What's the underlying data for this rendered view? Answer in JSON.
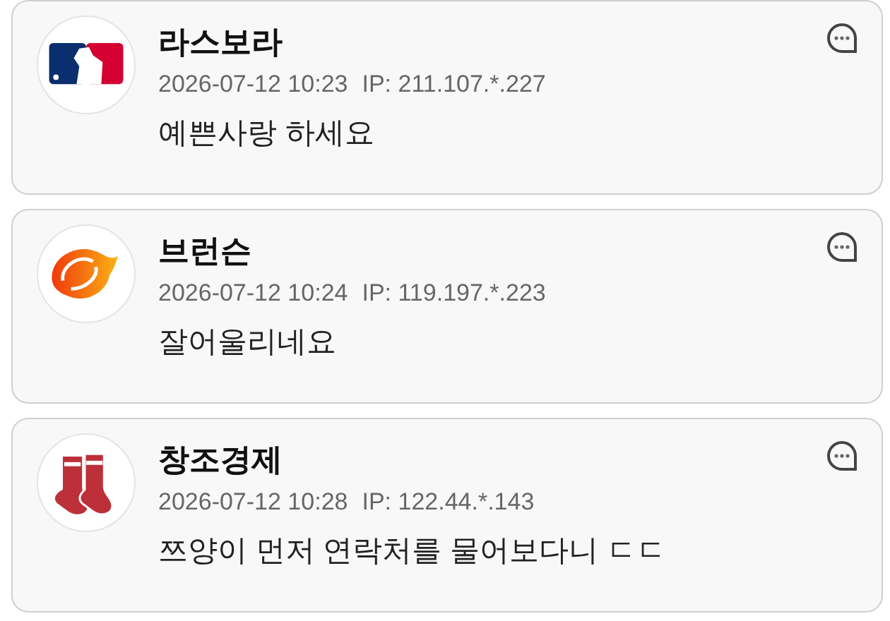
{
  "comments": [
    {
      "author": "라스보라",
      "time": "2026-07-12 10:23",
      "ip": "IP: 211.107.*.227",
      "text": "예쁜사랑 하세요"
    },
    {
      "author": "브런슨",
      "time": "2026-07-12 10:24",
      "ip": "IP: 119.197.*.223",
      "text": "잘어울리네요"
    },
    {
      "author": "창조경제",
      "time": "2026-07-12 10:28",
      "ip": "IP: 122.44.*.143",
      "text": "쯔양이 먼저 연락처를 물어보다니 ㄷㄷ"
    }
  ]
}
